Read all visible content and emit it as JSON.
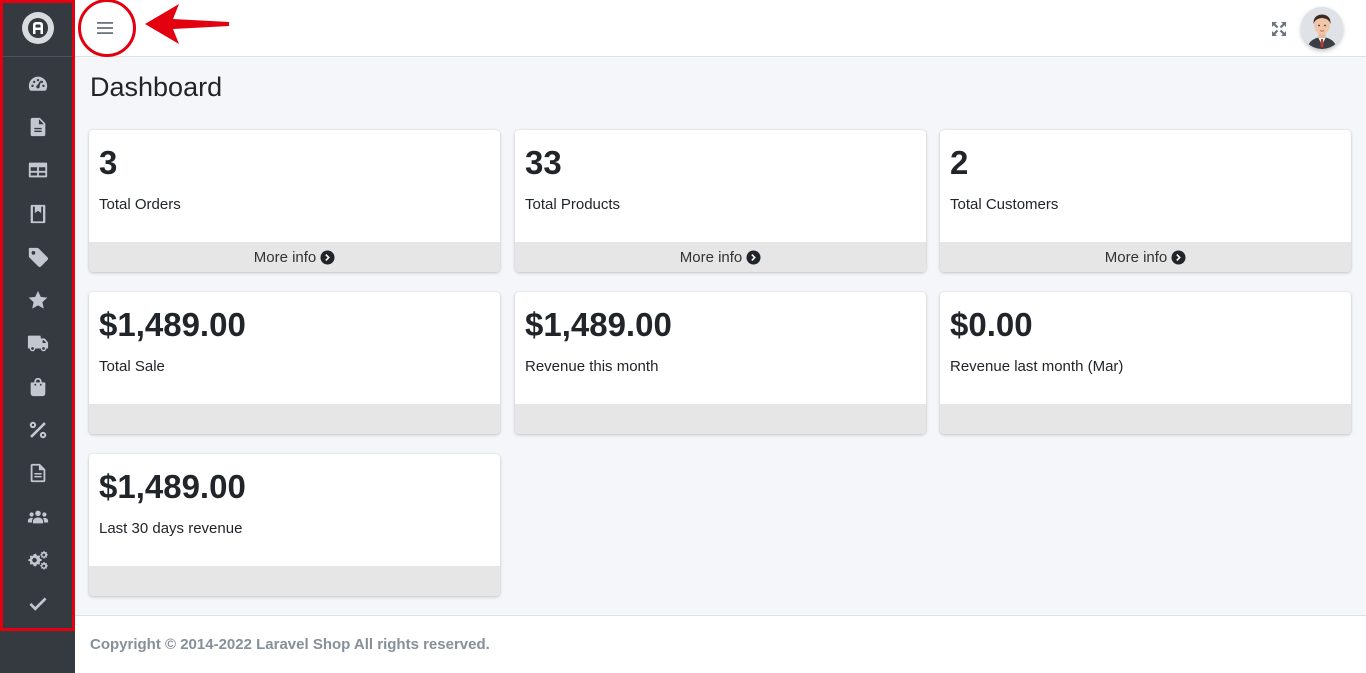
{
  "page": {
    "title": "Dashboard"
  },
  "sidebar": {
    "brand_icon": "shop-logo-icon",
    "items": [
      {
        "icon": "tachometer-icon",
        "name": "dashboard"
      },
      {
        "icon": "file-icon",
        "name": "pages"
      },
      {
        "icon": "table-icon",
        "name": "categories"
      },
      {
        "icon": "book-icon",
        "name": "catalog"
      },
      {
        "icon": "tag-icon",
        "name": "products"
      },
      {
        "icon": "star-icon",
        "name": "reviews"
      },
      {
        "icon": "truck-icon",
        "name": "shipping"
      },
      {
        "icon": "shopping-bag-icon",
        "name": "orders"
      },
      {
        "icon": "percent-icon",
        "name": "coupons"
      },
      {
        "icon": "file-alt-icon",
        "name": "reports"
      },
      {
        "icon": "users-icon",
        "name": "customers"
      },
      {
        "icon": "cogs-icon",
        "name": "settings"
      },
      {
        "icon": "check-icon",
        "name": "status"
      }
    ]
  },
  "header": {
    "menu_icon": "hamburger-icon",
    "fullscreen_icon": "expand-icon",
    "avatar_icon": "user-avatar"
  },
  "cards": [
    {
      "value": "3",
      "label": "Total Orders",
      "footer": "More info"
    },
    {
      "value": "33",
      "label": "Total Products",
      "footer": "More info"
    },
    {
      "value": "2",
      "label": "Total Customers",
      "footer": "More info"
    },
    {
      "value": "$1,489.00",
      "label": "Total Sale",
      "footer": ""
    },
    {
      "value": "$1,489.00",
      "label": "Revenue this month",
      "footer": ""
    },
    {
      "value": "$0.00",
      "label": "Revenue last month (Mar)",
      "footer": ""
    },
    {
      "value": "$1,489.00",
      "label": "Last 30 days revenue",
      "footer": ""
    }
  ],
  "footer": {
    "copyright": "Copyright © 2014-2022 Laravel Shop All rights reserved."
  },
  "colors": {
    "sidebar_bg": "#343a40",
    "annotation_red": "#e3000f",
    "page_bg": "#f4f6f9",
    "card_footer_bg": "#e6e6e6"
  }
}
